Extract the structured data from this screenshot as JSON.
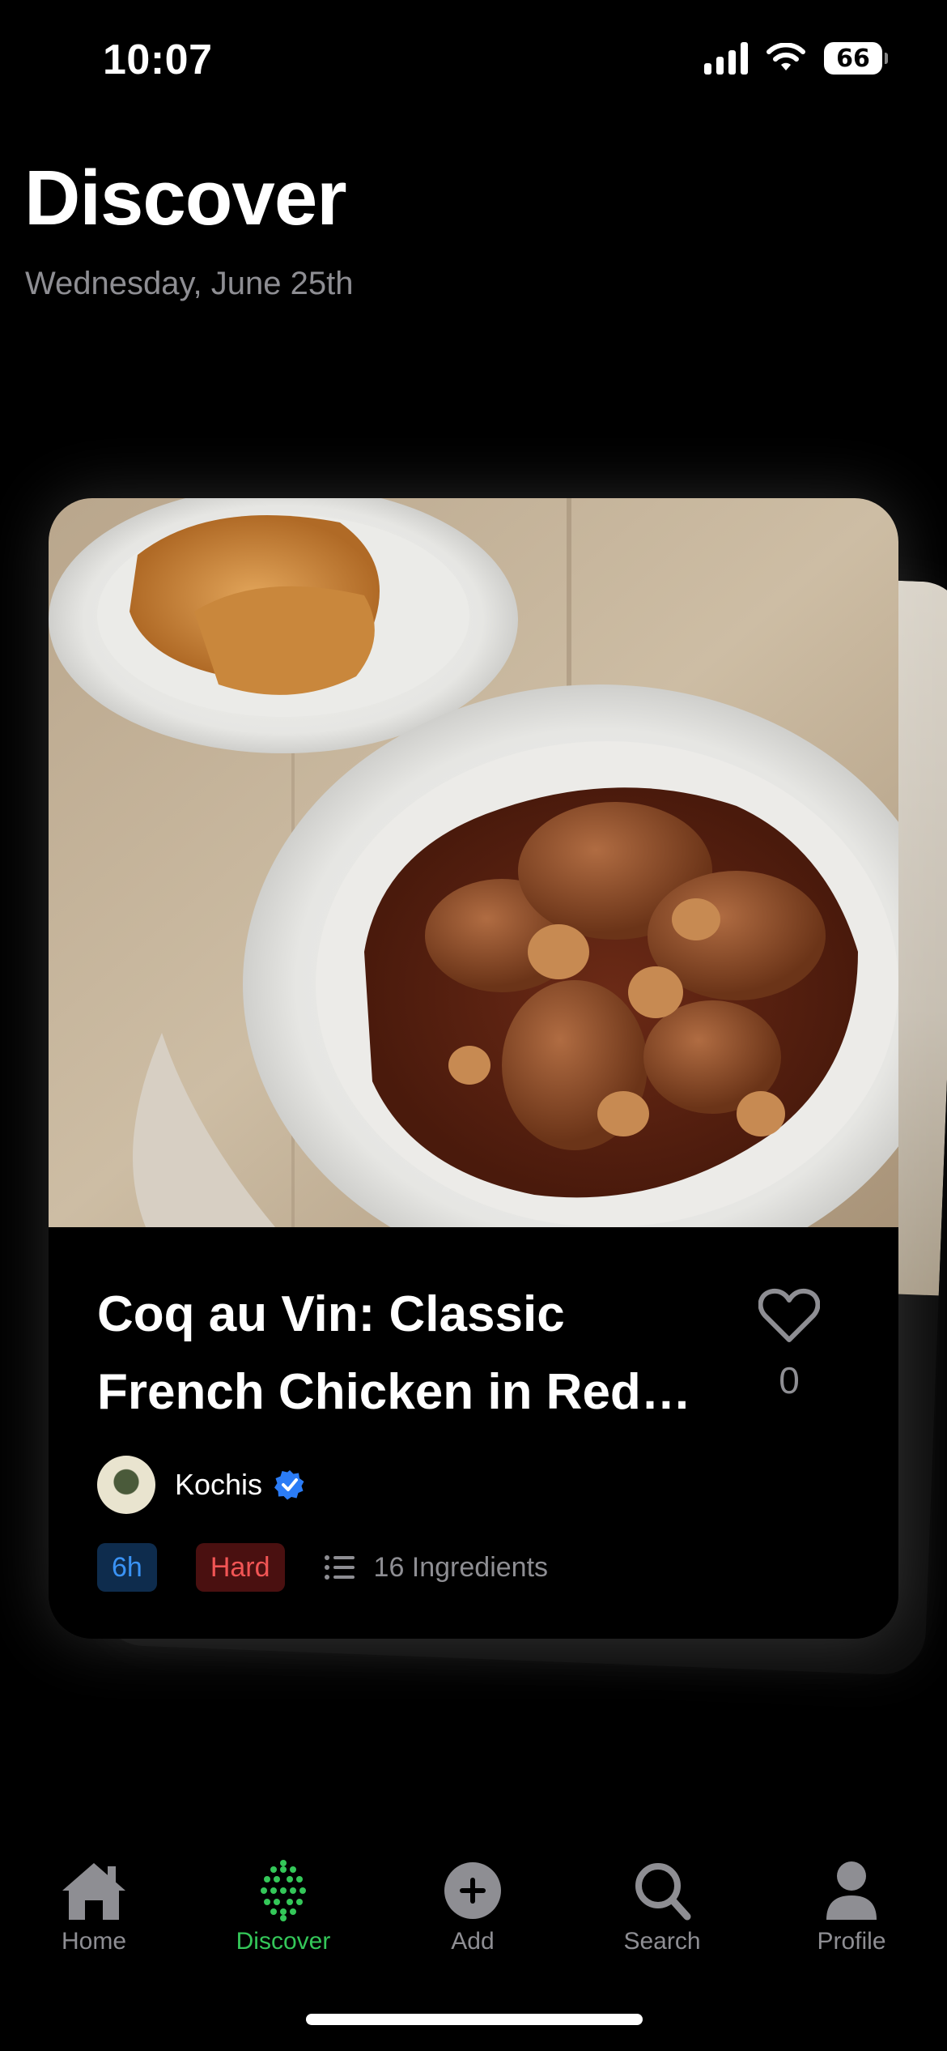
{
  "status_bar": {
    "time": "10:07",
    "battery_level": "66"
  },
  "header": {
    "title": "Discover",
    "date": "Wednesday, June 25th"
  },
  "recipe_card": {
    "title": "Coq au Vin: Classic French Chicken in Red Wine",
    "likes": "0",
    "author": "Kochis",
    "author_verified": true,
    "time_badge": "6h",
    "difficulty_badge": "Hard",
    "ingredients_label": "16 Ingredients"
  },
  "tab_bar": {
    "tabs": [
      {
        "label": "Home",
        "icon": "house-icon",
        "active": false
      },
      {
        "label": "Discover",
        "icon": "dots-grid-icon",
        "active": true
      },
      {
        "label": "Add",
        "icon": "plus-circle-icon",
        "active": false
      },
      {
        "label": "Search",
        "icon": "magnifier-icon",
        "active": false
      },
      {
        "label": "Profile",
        "icon": "person-icon",
        "active": false
      }
    ]
  },
  "colors": {
    "accent_green": "#34c759",
    "verified_blue": "#2b7cf6",
    "time_badge_text": "#3a93f5",
    "difficulty_badge_text": "#f25555",
    "secondary_text": "#8e8e93"
  }
}
